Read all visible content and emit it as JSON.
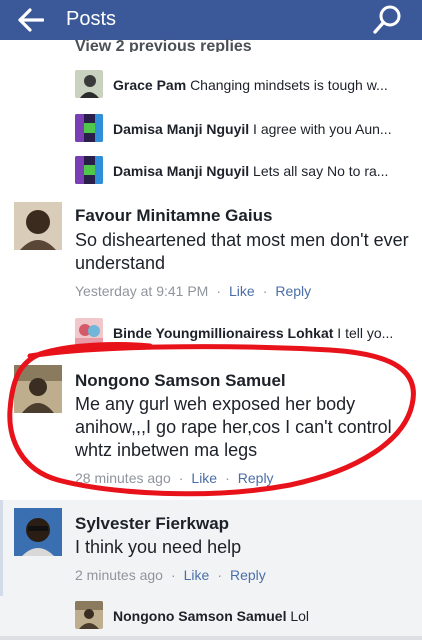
{
  "header": {
    "title": "Posts"
  },
  "thread": {
    "view_previous": "View 2 previous replies"
  },
  "replies_top": [
    {
      "name": "Grace Pam",
      "text": "Changing mindsets is tough w..."
    },
    {
      "name": "Damisa Manji Nguyil",
      "text": "I agree with you Aun..."
    },
    {
      "name": "Damisa Manji Nguyil",
      "text": "Lets all say No to ra..."
    }
  ],
  "comment1": {
    "name": "Favour Minitamne Gaius",
    "body": "So disheartened that most men don't ever understand",
    "time": "Yesterday at 9:41 PM",
    "like": "Like",
    "reply": "Reply",
    "sep": "·"
  },
  "reply_mid": {
    "name": "Binde Youngmillionairess Lohkat",
    "text": "I tell yo..."
  },
  "comment2": {
    "name": "Nongono Samson Samuel",
    "body": "Me any gurl weh exposed her body anihow,,,I go rape her,cos I can't control whtz inbetwen ma legs",
    "time": "28 minutes ago",
    "like": "Like",
    "reply": "Reply",
    "sep": "·"
  },
  "comment3": {
    "name": "Sylvester Fierkwap",
    "body": "I think you need help",
    "time": "2 minutes ago",
    "like": "Like",
    "reply": "Reply",
    "sep": "·"
  },
  "reply_bottom": {
    "name": "Nongono Samson Samuel",
    "text": "Lol"
  },
  "colors": {
    "header": "#3b5998",
    "link": "#4b6ea8",
    "annotation": "#e8121a"
  }
}
